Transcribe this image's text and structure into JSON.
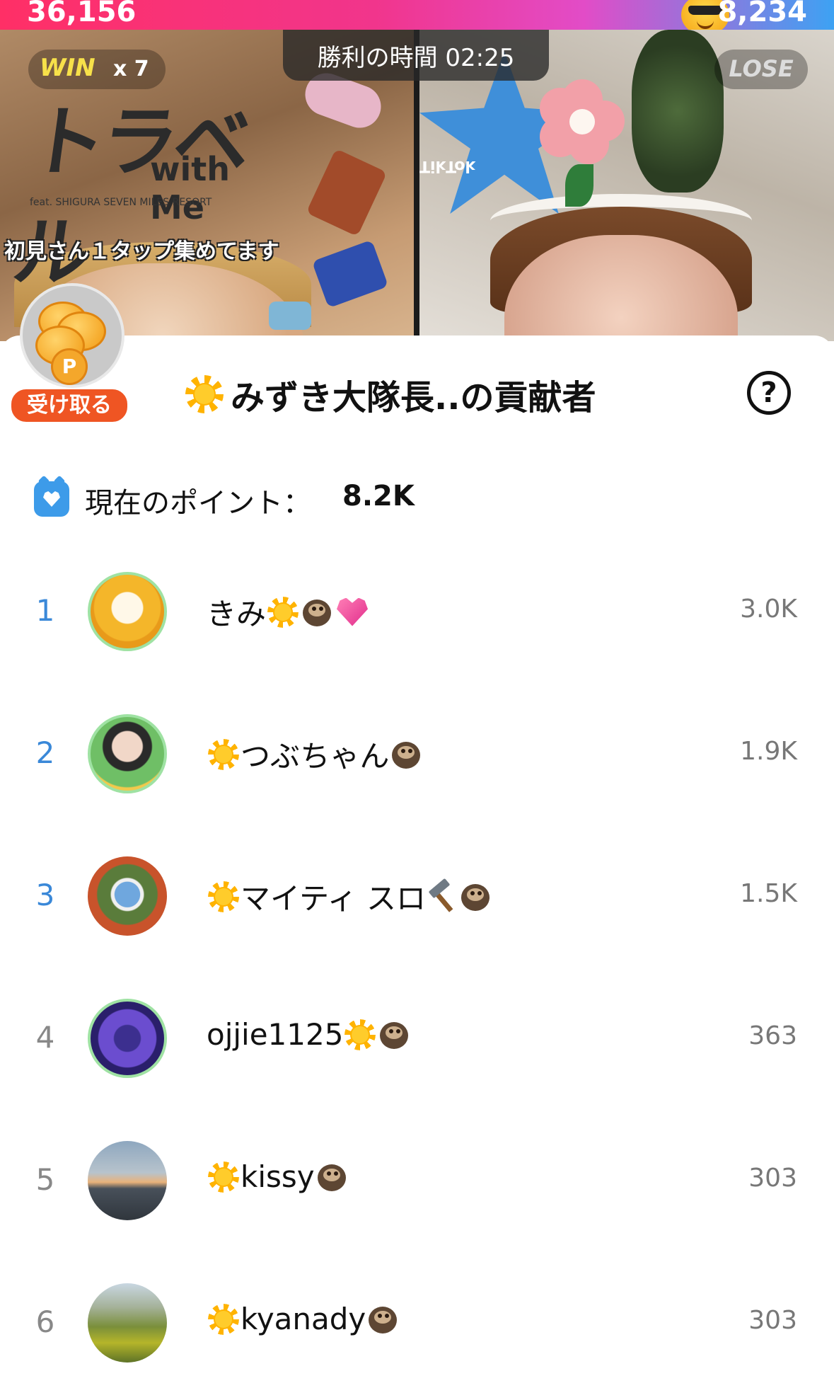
{
  "battle": {
    "left_score": "36,156",
    "right_score": "8,234",
    "win_label": "WIN",
    "win_count": "x 7",
    "timer_text": "勝利の時間 02:25",
    "lose_label": "LOSE",
    "left_stream_banner": "初見さん１タップ集めてます",
    "left_stream_poster_title": "トラベル",
    "left_stream_poster_sub": "with Me",
    "left_stream_poster_feat": "feat. SHIGURA SEVEN MILES RESORT",
    "right_stream_pillow_text": "TikTok"
  },
  "claim": {
    "button_label": "受け取る"
  },
  "sheet": {
    "title": "みずき大隊長..の貢献者",
    "points_label": "現在のポイント：",
    "points_value": "8.2K"
  },
  "contributors": [
    {
      "rank": "1",
      "name": "きみ",
      "score": "3.0K"
    },
    {
      "rank": "2",
      "name": "つぶちゃん",
      "score": "1.9K"
    },
    {
      "rank": "3",
      "name": "マイティ スロ",
      "score": "1.5K"
    },
    {
      "rank": "4",
      "name": "ojjie1125",
      "score": "363"
    },
    {
      "rank": "5",
      "name": "kissy",
      "score": "303"
    },
    {
      "rank": "6",
      "name": "kyanady",
      "score": "303"
    }
  ],
  "colors": {
    "rank_top": "#3a88d8",
    "rank_rest": "#888888",
    "claim_button": "#ef5523",
    "points_icon": "#3d9be9"
  },
  "icons": {
    "title_prefix": "sun-icon",
    "help": "question-circle-icon",
    "points": "alarm-clock-heart-icon",
    "claim": "coin-stack-icon",
    "name_decorations": [
      "sun-icon",
      "sloth-icon",
      "sparkling-heart-icon",
      "hammer-icon"
    ]
  }
}
